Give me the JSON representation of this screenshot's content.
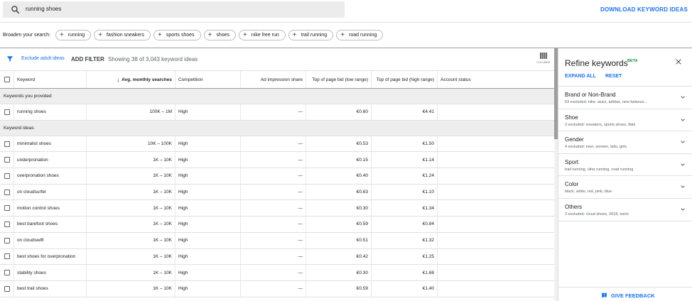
{
  "search": {
    "query": "running shoes"
  },
  "header": {
    "download_label": "DOWNLOAD KEYWORD IDEAS"
  },
  "broaden": {
    "label": "Broaden your search:",
    "chips": [
      "running",
      "fashion sneakers",
      "sports shoes",
      "shoes",
      "nike free run",
      "trail running",
      "road running"
    ]
  },
  "filterbar": {
    "exclude_label": "Exclude adult ideas",
    "add_filter_label": "ADD FILTER",
    "showing_text": "Showing 38 of 3,043 keyword ideas",
    "columns_label": "COLUMNS"
  },
  "table": {
    "columns": [
      "Keyword",
      "Avg. monthly searches",
      "Competition",
      "Ad impression share",
      "Top of page bid (low range)",
      "Top of page bid (high range)",
      "Account status"
    ],
    "sections": [
      {
        "title": "Keywords you provided",
        "rows": [
          {
            "keyword": "running shoes",
            "searches": "100K – 1M",
            "competition": "High",
            "impression": "—",
            "low": "€0.60",
            "high": "€4.41",
            "status": ""
          }
        ]
      },
      {
        "title": "Keyword ideas",
        "rows": [
          {
            "keyword": "minimalist shoes",
            "searches": "10K – 100K",
            "competition": "High",
            "impression": "—",
            "low": "€0.53",
            "high": "€1.50",
            "status": ""
          },
          {
            "keyword": "underpronation",
            "searches": "1K – 10K",
            "competition": "High",
            "impression": "—",
            "low": "€0.15",
            "high": "€1.14",
            "status": ""
          },
          {
            "keyword": "overpronation shoes",
            "searches": "1K – 10K",
            "competition": "High",
            "impression": "—",
            "low": "€0.40",
            "high": "€1.24",
            "status": ""
          },
          {
            "keyword": "on cloudsurfer",
            "searches": "1K – 10K",
            "competition": "High",
            "impression": "—",
            "low": "€0.63",
            "high": "€1.10",
            "status": ""
          },
          {
            "keyword": "motion control shoes",
            "searches": "1K – 10K",
            "competition": "High",
            "impression": "—",
            "low": "€0.30",
            "high": "€1.34",
            "status": ""
          },
          {
            "keyword": "best barefoot shoes",
            "searches": "1K – 10K",
            "competition": "High",
            "impression": "—",
            "low": "€0.59",
            "high": "€0.84",
            "status": ""
          },
          {
            "keyword": "on cloudswift",
            "searches": "1K – 10K",
            "competition": "High",
            "impression": "—",
            "low": "€0.51",
            "high": "€1.32",
            "status": ""
          },
          {
            "keyword": "best shoes for overpronation",
            "searches": "1K – 10K",
            "competition": "High",
            "impression": "—",
            "low": "€0.42",
            "high": "€1.25",
            "status": ""
          },
          {
            "keyword": "stability shoes",
            "searches": "1K – 10K",
            "competition": "High",
            "impression": "—",
            "low": "€0.30",
            "high": "€1.68",
            "status": ""
          },
          {
            "keyword": "best trail shoes",
            "searches": "1K – 10K",
            "competition": "High",
            "impression": "—",
            "low": "€0.59",
            "high": "€1.40",
            "status": ""
          }
        ]
      }
    ]
  },
  "refine": {
    "title": "Refine keywords",
    "beta": "BETA",
    "expand_all": "EXPAND ALL",
    "reset": "RESET",
    "groups": [
      {
        "title": "Brand or Non-Brand",
        "subtitle": "63 excluded: nike, asics, adidas, new balance..."
      },
      {
        "title": "Shoe",
        "subtitle": "3 excluded: sneakers, sports shoes, flats"
      },
      {
        "title": "Gender",
        "subtitle": "4 excluded: men, women, kids, girls"
      },
      {
        "title": "Sport",
        "subtitle": "trail running, ultra running, road running"
      },
      {
        "title": "Color",
        "subtitle": "black, white, red, pink, blue"
      },
      {
        "title": "Others",
        "subtitle": "3 excluded: cloud shoes, 2018, sonic"
      }
    ],
    "feedback_label": "GIVE FEEDBACK"
  },
  "colors": {
    "accent": "#1a73e8",
    "beta": "#1e8e3e",
    "section_bg": "#eeeeee"
  }
}
